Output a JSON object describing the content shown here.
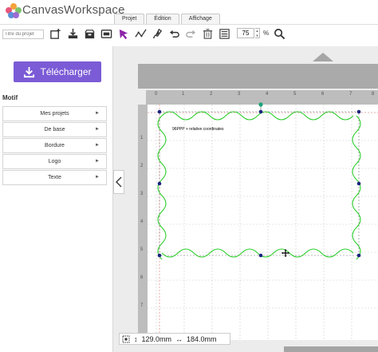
{
  "app": {
    "title": "CanvasWorkspace"
  },
  "tabs": [
    {
      "label": "Projet"
    },
    {
      "label": "Édition"
    },
    {
      "label": "Affichage"
    }
  ],
  "toolbar": {
    "title_placeholder": "Titre du projet",
    "zoom_value": "75",
    "zoom_unit": "%",
    "icons": [
      "add-object-icon",
      "import-icon",
      "box-icon",
      "scan-icon",
      "select-arrow-icon",
      "node-edit-icon",
      "freehand-icon",
      "undo-icon",
      "redo-icon",
      "trash-icon",
      "list-icon",
      "zoom-search-icon"
    ]
  },
  "sidebar": {
    "download_label": "Télécharger",
    "section_title": "Motif",
    "items": [
      {
        "label": "Mes projets"
      },
      {
        "label": "De base"
      },
      {
        "label": "Bordure"
      },
      {
        "label": "Logo"
      },
      {
        "label": "Texte"
      }
    ]
  },
  "canvas": {
    "ruler_top": [
      "0",
      "1",
      "2",
      "3",
      "4",
      "5",
      "6",
      "7",
      "8"
    ],
    "ruler_left": [
      "1",
      "2",
      "3",
      "4",
      "5",
      "6",
      "7"
    ],
    "design_text": "96PPP + relative coordinates"
  },
  "status": {
    "height": "129.0mm",
    "width": "184.0mm"
  },
  "colors": {
    "accent": "#7b5bd6",
    "selection_border": "#22cc22",
    "handle": "#1a237e",
    "rotate_handle": "#1aa37a"
  }
}
